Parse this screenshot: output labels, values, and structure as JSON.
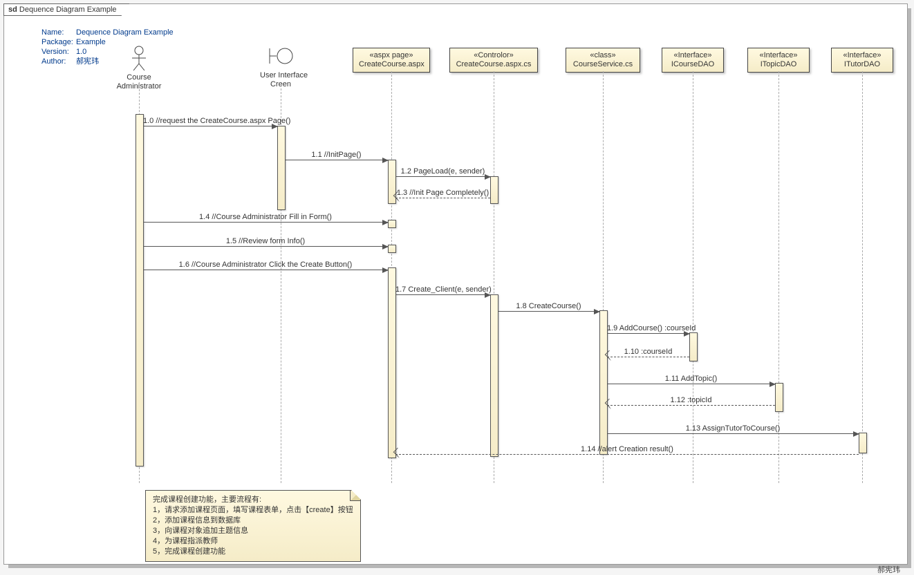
{
  "frame": {
    "prefix": "sd",
    "title": "Dequence Diagram Example"
  },
  "info": {
    "name_k": "Name:",
    "name_v": "Dequence Diagram Example",
    "pkg_k": "Package:",
    "pkg_v": "Example",
    "ver_k": "Version:",
    "ver_v": "1.0",
    "auth_k": "Author:",
    "auth_v": "郝宪玮"
  },
  "participants": {
    "actor": "Course Administrator",
    "boundary": "User Interface\nCreen",
    "p3": {
      "stereo": "«aspx page»",
      "name": "CreateCourse.aspx"
    },
    "p4": {
      "stereo": "«Controlor»",
      "name": "CreateCourse.aspx.cs"
    },
    "p5": {
      "stereo": "«class»",
      "name": "CourseService.cs"
    },
    "p6": {
      "stereo": "«Interface»",
      "name": "ICourseDAO"
    },
    "p7": {
      "stereo": "«Interface»",
      "name": "ITopicDAO"
    },
    "p8": {
      "stereo": "«Interface»",
      "name": "ITutorDAO"
    }
  },
  "messages": {
    "m1": "1.0 //request the CreateCourse.aspx Page()",
    "m2": "1.1 //InitPage()",
    "m3": "1.2 PageLoad(e, sender)",
    "m4": "1.3 //Init Page Completely()",
    "m5": "1.4 //Course Administrator Fill in  Form()",
    "m6": "1.5 //Review  form Info()",
    "m7": "1.6 //Course Administrator Click the Create Button()",
    "m8": "1.7 Create_Client(e, sender)",
    "m9": "1.8 CreateCourse()",
    "m10": "1.9 AddCourse() :courseId",
    "m11": "1.10  :courseId",
    "m12": "1.11 AddTopic()",
    "m13": "1.12  :topicId",
    "m14": "1.13 AssignTutorToCourse()",
    "m15": "1.14 //alert Creation result()"
  },
  "note": {
    "title": "完成课程创建功能，主要流程有:",
    "l1": "1，请求添加课程页面，填写课程表单，点击【create】按钮",
    "l2": "2，添加课程信息到数据库",
    "l3": "3，向课程对象追加主题信息",
    "l4": "4，为课程指派教师",
    "l5": "5，完成课程创建功能"
  },
  "footer_author": "郝宪玮"
}
